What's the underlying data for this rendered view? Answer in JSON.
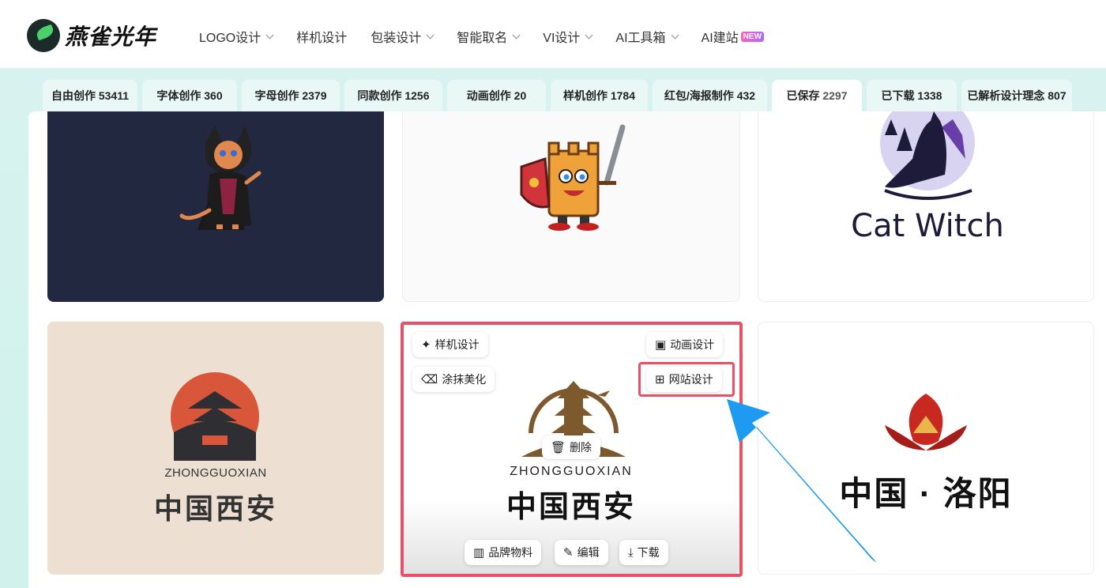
{
  "brand": {
    "name": "燕雀光年"
  },
  "nav": [
    {
      "label": "LOGO设计",
      "dropdown": true
    },
    {
      "label": "样机设计",
      "dropdown": false
    },
    {
      "label": "包装设计",
      "dropdown": true
    },
    {
      "label": "智能取名",
      "dropdown": true
    },
    {
      "label": "VI设计",
      "dropdown": true
    },
    {
      "label": "AI工具箱",
      "dropdown": true
    },
    {
      "label": "AI建站",
      "dropdown": false,
      "badge": "NEW"
    }
  ],
  "tabs": [
    {
      "label": "自由创作",
      "count": "53411",
      "active": false
    },
    {
      "label": "字体创作",
      "count": "360",
      "active": false
    },
    {
      "label": "字母创作",
      "count": "2379",
      "active": false
    },
    {
      "label": "同款创作",
      "count": "1256",
      "active": false
    },
    {
      "label": "动画创作",
      "count": "20",
      "active": false
    },
    {
      "label": "样机创作",
      "count": "1784",
      "active": false
    },
    {
      "label": "红包/海报制作",
      "count": "432",
      "active": false
    },
    {
      "label": "已保存",
      "count": "2297",
      "active": true
    },
    {
      "label": "已下载",
      "count": "1338",
      "active": false
    },
    {
      "label": "已解析设计理念",
      "count": "807",
      "active": false
    }
  ],
  "cards": {
    "catwitch": {
      "text": "Cat Witch"
    },
    "xian_left": {
      "pinyin": "ZHONGGUOXIAN",
      "title": "中国西安"
    },
    "xian_center": {
      "pinyin": "ZHONGGUOXIAN",
      "title": "中国西安"
    },
    "luoyang": {
      "title": "中国 · 洛阳"
    }
  },
  "actions": {
    "mockup": "样机设计",
    "animation": "动画设计",
    "smear": "涂抹美化",
    "website": "网站设计",
    "delete": "删除",
    "brand_material": "品牌物料",
    "edit": "编辑",
    "download": "下载"
  },
  "colors": {
    "accent": "#e94f65",
    "arrow": "#1e9bf0",
    "tab_bg": "#d3f2ed"
  }
}
